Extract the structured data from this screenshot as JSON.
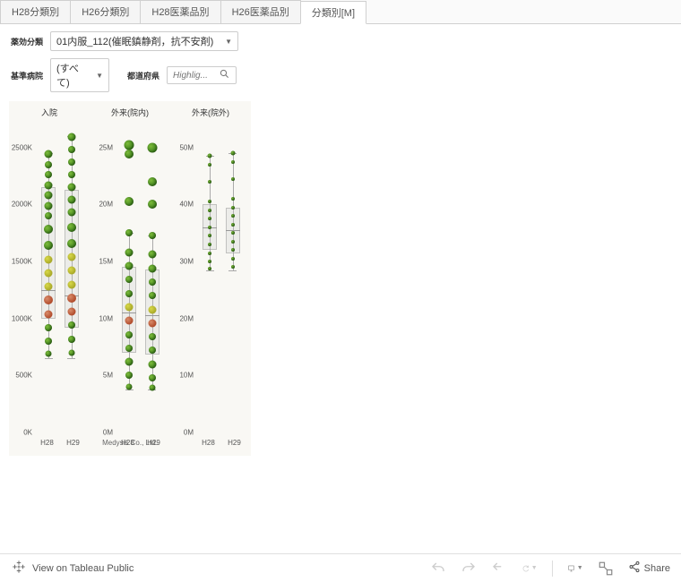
{
  "tabs": [
    {
      "label": "H28分類別",
      "active": false
    },
    {
      "label": "H26分類別",
      "active": false
    },
    {
      "label": "H28医薬品別",
      "active": false
    },
    {
      "label": "H26医薬品別",
      "active": false
    },
    {
      "label": "分類別[M]",
      "active": true
    }
  ],
  "filters": {
    "yakkou_label": "薬効分類",
    "yakkou_value": "01内服_112(催眠鎮静剤，抗不安剤)",
    "kijun_label": "基準病院",
    "kijun_value": "(すべて)",
    "search_label": "都道府県",
    "search_placeholder": "Highlig..."
  },
  "credit": "Medysis Co., Ltd.",
  "bottom": {
    "view_label": "View on Tableau Public",
    "share_label": "Share"
  },
  "chart_data": [
    {
      "title": "入院",
      "ylim": [
        0,
        2750000
      ],
      "yticks": [
        0,
        500000,
        1000000,
        1500000,
        2000000,
        2500000
      ],
      "yticklabels": [
        "0K",
        "500K",
        "1000K",
        "1500K",
        "2000K",
        "2500K"
      ],
      "categories": [
        "H28",
        "H29"
      ],
      "box": [
        {
          "q1": 1000000,
          "median": 1250000,
          "q3": 2150000,
          "whisker_low": 650000,
          "whisker_high": 2450000
        },
        {
          "q1": 920000,
          "median": 1200000,
          "q3": 2130000,
          "whisker_low": 650000,
          "whisker_high": 2600000
        }
      ],
      "points": {
        "H28": [
          {
            "y": 2440000,
            "size": 9,
            "color": "green"
          },
          {
            "y": 2350000,
            "size": 8,
            "color": "green"
          },
          {
            "y": 2260000,
            "size": 8,
            "color": "green"
          },
          {
            "y": 2170000,
            "size": 9,
            "color": "green"
          },
          {
            "y": 2080000,
            "size": 9,
            "color": "green"
          },
          {
            "y": 1990000,
            "size": 9,
            "color": "green"
          },
          {
            "y": 1900000,
            "size": 8,
            "color": "green"
          },
          {
            "y": 1780000,
            "size": 10,
            "color": "green"
          },
          {
            "y": 1640000,
            "size": 10,
            "color": "green"
          },
          {
            "y": 1520000,
            "size": 9,
            "color": "yellow"
          },
          {
            "y": 1400000,
            "size": 9,
            "color": "yellow"
          },
          {
            "y": 1280000,
            "size": 9,
            "color": "yellow"
          },
          {
            "y": 1160000,
            "size": 10,
            "color": "red"
          },
          {
            "y": 1040000,
            "size": 9,
            "color": "red"
          },
          {
            "y": 920000,
            "size": 8,
            "color": "green"
          },
          {
            "y": 800000,
            "size": 8,
            "color": "green"
          },
          {
            "y": 690000,
            "size": 7,
            "color": "green"
          }
        ],
        "H29": [
          {
            "y": 2590000,
            "size": 9,
            "color": "green"
          },
          {
            "y": 2480000,
            "size": 8,
            "color": "green"
          },
          {
            "y": 2370000,
            "size": 8,
            "color": "green"
          },
          {
            "y": 2260000,
            "size": 8,
            "color": "green"
          },
          {
            "y": 2150000,
            "size": 9,
            "color": "green"
          },
          {
            "y": 2040000,
            "size": 9,
            "color": "green"
          },
          {
            "y": 1930000,
            "size": 9,
            "color": "green"
          },
          {
            "y": 1800000,
            "size": 10,
            "color": "green"
          },
          {
            "y": 1660000,
            "size": 10,
            "color": "green"
          },
          {
            "y": 1540000,
            "size": 9,
            "color": "yellow"
          },
          {
            "y": 1420000,
            "size": 9,
            "color": "yellow"
          },
          {
            "y": 1300000,
            "size": 9,
            "color": "yellow"
          },
          {
            "y": 1180000,
            "size": 10,
            "color": "red"
          },
          {
            "y": 1060000,
            "size": 9,
            "color": "red"
          },
          {
            "y": 940000,
            "size": 8,
            "color": "green"
          },
          {
            "y": 820000,
            "size": 8,
            "color": "green"
          },
          {
            "y": 700000,
            "size": 7,
            "color": "green"
          }
        ]
      }
    },
    {
      "title": "外来(院内)",
      "ylim": [
        0,
        27500000
      ],
      "yticks": [
        0,
        5000000,
        10000000,
        15000000,
        20000000,
        25000000
      ],
      "yticklabels": [
        "0M",
        "5M",
        "10M",
        "15M",
        "20M",
        "25M"
      ],
      "categories": [
        "H28",
        "H29"
      ],
      "box": [
        {
          "q1": 7000000,
          "median": 10500000,
          "q3": 14500000,
          "whisker_low": 3800000,
          "whisker_high": 17500000
        },
        {
          "q1": 6800000,
          "median": 10300000,
          "q3": 14300000,
          "whisker_low": 3800000,
          "whisker_high": 17300000
        }
      ],
      "points": {
        "H28": [
          {
            "y": 25200000,
            "size": 11,
            "color": "green"
          },
          {
            "y": 24400000,
            "size": 10,
            "color": "green"
          },
          {
            "y": 20300000,
            "size": 10,
            "color": "green"
          },
          {
            "y": 17500000,
            "size": 8,
            "color": "green"
          },
          {
            "y": 15800000,
            "size": 9,
            "color": "green"
          },
          {
            "y": 14600000,
            "size": 9,
            "color": "green"
          },
          {
            "y": 13400000,
            "size": 8,
            "color": "green"
          },
          {
            "y": 12200000,
            "size": 8,
            "color": "green"
          },
          {
            "y": 11000000,
            "size": 9,
            "color": "yellow"
          },
          {
            "y": 9800000,
            "size": 9,
            "color": "red"
          },
          {
            "y": 8600000,
            "size": 8,
            "color": "green"
          },
          {
            "y": 7400000,
            "size": 8,
            "color": "green"
          },
          {
            "y": 6200000,
            "size": 9,
            "color": "green"
          },
          {
            "y": 5000000,
            "size": 8,
            "color": "green"
          },
          {
            "y": 4000000,
            "size": 7,
            "color": "green"
          }
        ],
        "H29": [
          {
            "y": 25000000,
            "size": 11,
            "color": "green"
          },
          {
            "y": 22000000,
            "size": 10,
            "color": "green"
          },
          {
            "y": 20000000,
            "size": 10,
            "color": "green"
          },
          {
            "y": 17300000,
            "size": 8,
            "color": "green"
          },
          {
            "y": 15600000,
            "size": 9,
            "color": "green"
          },
          {
            "y": 14400000,
            "size": 9,
            "color": "green"
          },
          {
            "y": 13200000,
            "size": 8,
            "color": "green"
          },
          {
            "y": 12000000,
            "size": 8,
            "color": "green"
          },
          {
            "y": 10800000,
            "size": 9,
            "color": "yellow"
          },
          {
            "y": 9600000,
            "size": 9,
            "color": "red"
          },
          {
            "y": 8400000,
            "size": 8,
            "color": "green"
          },
          {
            "y": 7200000,
            "size": 8,
            "color": "green"
          },
          {
            "y": 6000000,
            "size": 9,
            "color": "green"
          },
          {
            "y": 4800000,
            "size": 8,
            "color": "green"
          },
          {
            "y": 3900000,
            "size": 7,
            "color": "green"
          }
        ]
      }
    },
    {
      "title": "外来(院外)",
      "ylim": [
        0,
        55000000
      ],
      "yticks": [
        0,
        10000000,
        20000000,
        30000000,
        40000000,
        50000000
      ],
      "yticklabels": [
        "0M",
        "10M",
        "20M",
        "30M",
        "40M",
        "50M"
      ],
      "categories": [
        "H28",
        "H29"
      ],
      "box": [
        {
          "q1": 32000000,
          "median": 36000000,
          "q3": 40000000,
          "whisker_low": 28500000,
          "whisker_high": 48500000
        },
        {
          "q1": 31500000,
          "median": 35500000,
          "q3": 39500000,
          "whisker_low": 28500000,
          "whisker_high": 49000000
        }
      ],
      "points": {
        "H28": [
          {
            "y": 48500000,
            "size": 5,
            "color": "green"
          },
          {
            "y": 47000000,
            "size": 4,
            "color": "green"
          },
          {
            "y": 44000000,
            "size": 4,
            "color": "green"
          },
          {
            "y": 40500000,
            "size": 4,
            "color": "green"
          },
          {
            "y": 39000000,
            "size": 4,
            "color": "green"
          },
          {
            "y": 37500000,
            "size": 4,
            "color": "green"
          },
          {
            "y": 36000000,
            "size": 4,
            "color": "green"
          },
          {
            "y": 34500000,
            "size": 4,
            "color": "green"
          },
          {
            "y": 33000000,
            "size": 4,
            "color": "green"
          },
          {
            "y": 31500000,
            "size": 4,
            "color": "green"
          },
          {
            "y": 30000000,
            "size": 4,
            "color": "green"
          },
          {
            "y": 28800000,
            "size": 4,
            "color": "green"
          }
        ],
        "H29": [
          {
            "y": 49000000,
            "size": 5,
            "color": "green"
          },
          {
            "y": 47500000,
            "size": 4,
            "color": "green"
          },
          {
            "y": 44500000,
            "size": 4,
            "color": "green"
          },
          {
            "y": 41000000,
            "size": 4,
            "color": "green"
          },
          {
            "y": 39500000,
            "size": 4,
            "color": "green"
          },
          {
            "y": 38000000,
            "size": 4,
            "color": "green"
          },
          {
            "y": 36500000,
            "size": 4,
            "color": "green"
          },
          {
            "y": 35000000,
            "size": 4,
            "color": "green"
          },
          {
            "y": 33500000,
            "size": 4,
            "color": "green"
          },
          {
            "y": 32000000,
            "size": 4,
            "color": "green"
          },
          {
            "y": 30500000,
            "size": 4,
            "color": "green"
          },
          {
            "y": 29000000,
            "size": 4,
            "color": "green"
          }
        ]
      }
    }
  ]
}
